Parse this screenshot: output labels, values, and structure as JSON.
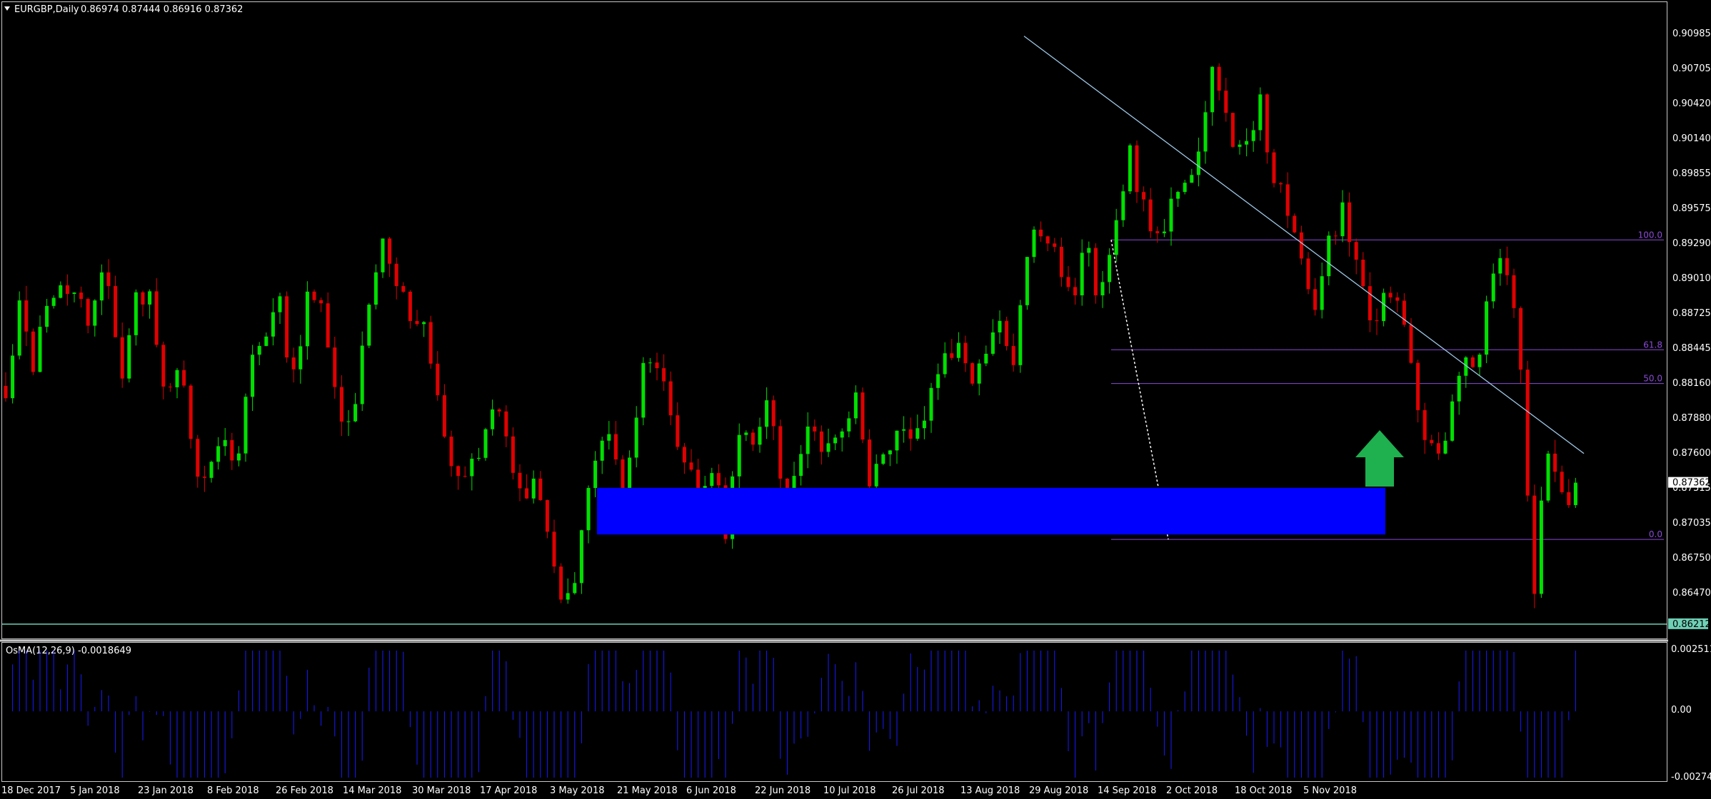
{
  "header": {
    "symbol": "EURGBP,Daily",
    "ohlc": "0.86974 0.87444 0.86916 0.87362",
    "menu_icon": "triangle-down-icon"
  },
  "indicator": {
    "title": "OsMA(12,26,9) -0.0018649",
    "axis_ticks": [
      "0.002511",
      "0.00",
      "-0.002740"
    ],
    "color": "#1a1aff"
  },
  "price_axis": {
    "ticks": [
      "0.90985",
      "0.90705",
      "0.90420",
      "0.90140",
      "0.89855",
      "0.89575",
      "0.89290",
      "0.89010",
      "0.88725",
      "0.88445",
      "0.88160",
      "0.87880",
      "0.87600",
      "0.87315",
      "0.87035",
      "0.86750",
      "0.86470"
    ],
    "current_price": "0.87362",
    "support_price": "0.86212"
  },
  "time_axis": {
    "labels": [
      "18 Dec 2017",
      "5 Jan 2018",
      "23 Jan 2018",
      "8 Feb 2018",
      "26 Feb 2018",
      "14 Mar 2018",
      "30 Mar 2018",
      "17 Apr 2018",
      "3 May 2018",
      "21 May 2018",
      "6 Jun 2018",
      "22 Jun 2018",
      "10 Jul 2018",
      "26 Jul 2018",
      "13 Aug 2018",
      "29 Aug 2018",
      "14 Sep 2018",
      "2 Oct 2018",
      "18 Oct 2018",
      "5 Nov 2018"
    ]
  },
  "fibonacci": {
    "levels": [
      {
        "label": "100.0",
        "price": 0.8934
      },
      {
        "label": "61.8",
        "price": 0.88445
      },
      {
        "label": "50.0",
        "price": 0.8817
      },
      {
        "label": "0.0",
        "price": 0.869
      }
    ],
    "color": "#8a4bd6"
  },
  "colors": {
    "bull": "#00e000",
    "bear": "#e00000",
    "support_zone": "#0000ff",
    "arrow": "#1fb050",
    "trendline": "#9ec7e6",
    "support_line": "#6fd0b5"
  },
  "chart_data": {
    "type": "candlestick",
    "symbol": "EURGBP",
    "timeframe": "Daily",
    "ylim": [
      0.8618,
      0.9112
    ],
    "x_labels": [
      "18 Dec 2017",
      "5 Jan 2018",
      "23 Jan 2018",
      "8 Feb 2018",
      "26 Feb 2018",
      "14 Mar 2018",
      "30 Mar 2018",
      "17 Apr 2018",
      "3 May 2018",
      "21 May 2018",
      "6 Jun 2018",
      "22 Jun 2018",
      "10 Jul 2018",
      "26 Jul 2018",
      "13 Aug 2018",
      "29 Aug 2018",
      "14 Sep 2018",
      "2 Oct 2018",
      "18 Oct 2018",
      "5 Nov 2018"
    ],
    "close_path": [
      0.88,
      0.888,
      0.883,
      0.8895,
      0.89,
      0.888,
      0.887,
      0.892,
      0.882,
      0.888,
      0.89,
      0.881,
      0.884,
      0.875,
      0.873,
      0.878,
      0.874,
      0.884,
      0.886,
      0.888,
      0.882,
      0.89,
      0.887,
      0.88,
      0.879,
      0.886,
      0.894,
      0.891,
      0.887,
      0.886,
      0.88,
      0.875,
      0.874,
      0.876,
      0.88,
      0.876,
      0.872,
      0.874,
      0.866,
      0.864,
      0.869,
      0.876,
      0.877,
      0.872,
      0.882,
      0.885,
      0.88,
      0.876,
      0.872,
      0.875,
      0.87,
      0.878,
      0.876,
      0.88,
      0.873,
      0.876,
      0.879,
      0.876,
      0.878,
      0.881,
      0.874,
      0.876,
      0.879,
      0.877,
      0.88,
      0.884,
      0.885,
      0.882,
      0.885,
      0.887,
      0.884,
      0.893,
      0.895,
      0.892,
      0.888,
      0.893,
      0.888,
      0.894,
      0.901,
      0.896,
      0.893,
      0.896,
      0.899,
      0.901,
      0.908,
      0.902,
      0.9,
      0.905,
      0.899,
      0.895,
      0.892,
      0.888,
      0.894,
      0.896,
      0.89,
      0.886,
      0.89,
      0.886,
      0.88,
      0.876,
      0.877,
      0.884,
      0.883,
      0.889,
      0.892,
      0.887,
      0.864,
      0.8755,
      0.8735,
      0.8705
    ],
    "key_levels": {
      "swing_high": 0.91,
      "swing_low": 0.8621,
      "current": 0.87362
    },
    "support_zone": [
      0.8702,
      0.8722
    ],
    "annotations": [
      "descending trendline from Aug 2018 high",
      "fibonacci retracement 0.0 / 50.0 / 61.8 / 100.0",
      "blue support zone",
      "green up arrow"
    ],
    "osma": {
      "last": -0.0018649,
      "ylim": [
        -0.00274,
        0.002511
      ]
    }
  }
}
